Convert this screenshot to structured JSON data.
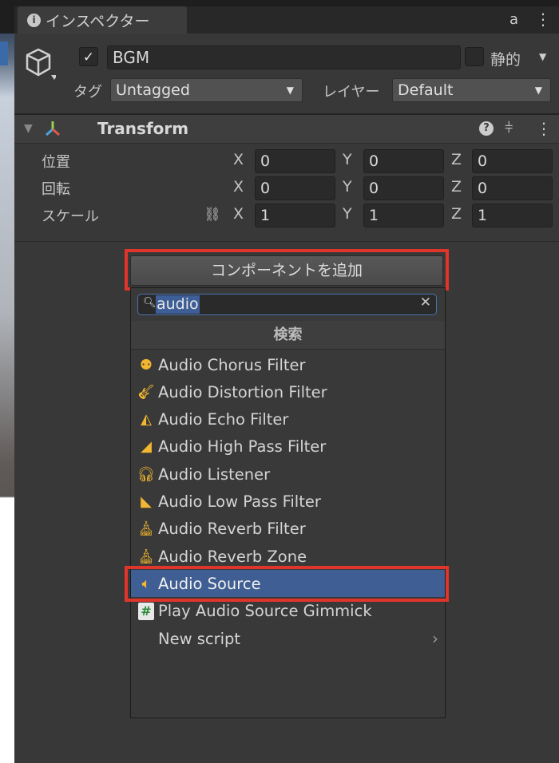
{
  "tab": {
    "title": "インスペクター",
    "icon": "info-icon"
  },
  "object": {
    "active": true,
    "name": "BGM",
    "static_label": "静的",
    "static_checked": false,
    "tag_label": "タグ",
    "tag_value": "Untagged",
    "layer_label": "レイヤー",
    "layer_value": "Default"
  },
  "transform": {
    "title": "Transform",
    "rows": [
      {
        "label": "位置",
        "x": "0",
        "y": "0",
        "z": "0"
      },
      {
        "label": "回転",
        "x": "0",
        "y": "0",
        "z": "0"
      },
      {
        "label": "スケール",
        "x": "1",
        "y": "1",
        "z": "1"
      }
    ],
    "axis": {
      "x": "X",
      "y": "Y",
      "z": "Z"
    }
  },
  "add_component": {
    "label": "コンポーネントを追加",
    "search_value": "audio",
    "header": "検索",
    "items": [
      {
        "label": "Audio Chorus Filter",
        "icon": "chorus-icon"
      },
      {
        "label": "Audio Distortion Filter",
        "icon": "guitar-icon"
      },
      {
        "label": "Audio Echo Filter",
        "icon": "echo-icon"
      },
      {
        "label": "Audio High Pass Filter",
        "icon": "high-pass-icon"
      },
      {
        "label": "Audio Listener",
        "icon": "headphones-icon"
      },
      {
        "label": "Audio Low Pass Filter",
        "icon": "low-pass-icon"
      },
      {
        "label": "Audio Reverb Filter",
        "icon": "church-icon"
      },
      {
        "label": "Audio Reverb Zone",
        "icon": "reverb-zone-icon"
      },
      {
        "label": "Audio Source",
        "icon": "speaker-icon",
        "selected": true
      },
      {
        "label": "Play Audio Source Gimmick",
        "icon": "script-icon"
      },
      {
        "label": "New script"
      }
    ]
  },
  "colors": {
    "highlight": "#e0352b",
    "selection": "#3f5e93",
    "icon": "#f2b630"
  }
}
